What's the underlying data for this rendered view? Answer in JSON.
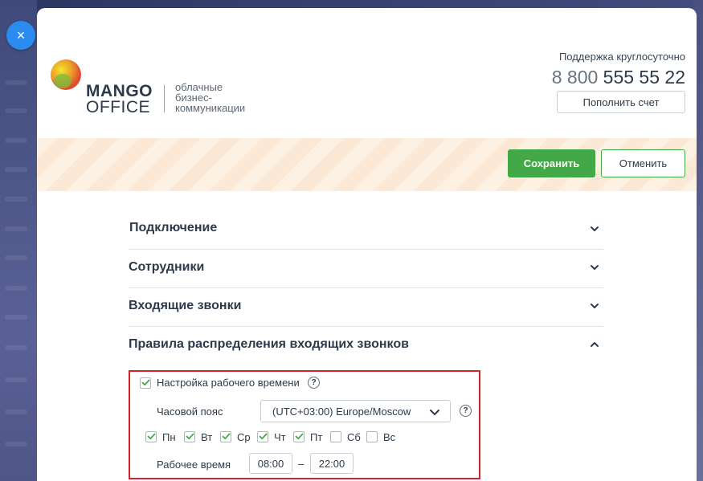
{
  "modal": {
    "close_symbol": "×",
    "logo": {
      "line1": "MANGO",
      "line2": "OFFICE",
      "tagline_1": "облачные",
      "tagline_2": "бизнес-",
      "tagline_3": "коммуникации"
    },
    "support": {
      "label": "Поддержка круглосуточно",
      "phone_prefix": "8 800",
      "phone_number": "555 55 22",
      "topup_label": "Пополнить счет"
    },
    "actions": {
      "save_label": "Сохранить",
      "cancel_label": "Отменить"
    }
  },
  "accordion": {
    "items": [
      {
        "label": "Подключение",
        "expanded": false
      },
      {
        "label": "Сотрудники",
        "expanded": false
      },
      {
        "label": "Входящие звонки",
        "expanded": false
      },
      {
        "label": "Правила распределения входящих звонков",
        "expanded": true
      }
    ]
  },
  "work_time": {
    "enabled_label": "Настройка рабочего времени",
    "enabled": true,
    "help_symbol": "?",
    "timezone_label": "Часовой пояс",
    "timezone_value": "(UTC+03:00) Europe/Moscow",
    "days": [
      {
        "label": "Пн",
        "checked": true
      },
      {
        "label": "Вт",
        "checked": true
      },
      {
        "label": "Ср",
        "checked": true
      },
      {
        "label": "Чт",
        "checked": true
      },
      {
        "label": "Пт",
        "checked": true
      },
      {
        "label": "Сб",
        "checked": false
      },
      {
        "label": "Вс",
        "checked": false
      }
    ],
    "hours_label": "Рабочее время",
    "start_time": "08:00",
    "separator": "–",
    "end_time": "22:00"
  },
  "colors": {
    "accent_green": "#43a847",
    "highlight_red": "#d4212a",
    "close_blue": "#2b8cf0",
    "text_dark": "#2d3a4b"
  },
  "icons": {
    "close": "close-icon",
    "chevron_down": "chevron-down-icon",
    "chevron_up": "chevron-up-icon",
    "help": "help-circle-icon",
    "check": "checkmark-icon"
  }
}
